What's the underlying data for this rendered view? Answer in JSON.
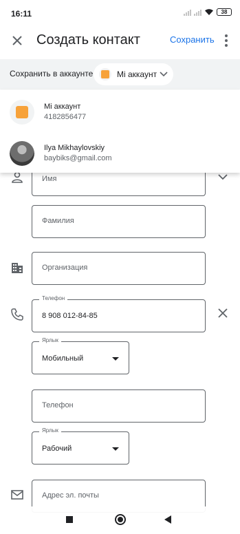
{
  "status_bar": {
    "time": "16:11",
    "battery": "38"
  },
  "app_bar": {
    "title": "Создать контакт",
    "save_label": "Сохранить",
    "close_icon": "close-icon",
    "more_icon": "more-vert-icon"
  },
  "account_bar": {
    "label": "Сохранить в аккаунте",
    "selected": "Mi аккаунт"
  },
  "account_menu": {
    "items": [
      {
        "name": "Mi аккаунт",
        "sub": "4182856477",
        "icon": "mi-account-icon"
      },
      {
        "name": "Ilya Mikhaylovskiy",
        "sub": "baybiks@gmail.com",
        "icon": "avatar"
      }
    ]
  },
  "form": {
    "first_name_placeholder": "Имя",
    "last_name_placeholder": "Фамилия",
    "organization_placeholder": "Организация",
    "phone1": {
      "label": "Телефон",
      "value": "8 908 012-84-85",
      "type_label": "Ярлык",
      "type_value": "Мобильный"
    },
    "phone2": {
      "placeholder": "Телефон",
      "type_label": "Ярлык",
      "type_value": "Рабочий"
    },
    "email_placeholder": "Адрес эл. почты"
  },
  "colors": {
    "accent": "#1a73e8",
    "mi_orange": "#f7a23a",
    "outline": "#5f6368",
    "account_bar_bg": "#f1f3f4"
  }
}
